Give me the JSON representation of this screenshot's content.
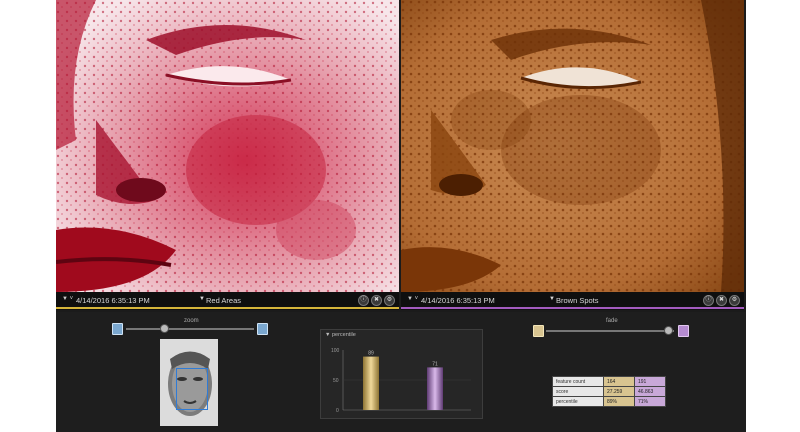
{
  "left_panel": {
    "timestamp": "4/14/2016 6:35:13 PM",
    "mode": "Red Areas",
    "accent_color": "#d6b53a",
    "tint_color": "#c2183b"
  },
  "right_panel": {
    "timestamp": "4/14/2016 6:35:13 PM",
    "mode": "Brown Spots",
    "accent_color": "#a35bbf",
    "tint_color": "#9b4a12"
  },
  "controls": {
    "info_icon": "ⓘ",
    "sync_icon": "✖",
    "gear_icon": "⚙"
  },
  "zoom": {
    "label": "zoom",
    "level": 0.3
  },
  "fade": {
    "label": "fade",
    "level": 0.95
  },
  "percentile_chart": {
    "title": "percentile",
    "ticks": [
      "100",
      "50",
      "0"
    ]
  },
  "chart_data": {
    "type": "bar",
    "categories": [
      "Red Areas",
      "Brown Spots"
    ],
    "values": [
      89,
      71
    ],
    "colors": [
      "#c9a855",
      "#9b6bb0"
    ],
    "ylim": [
      0,
      100
    ],
    "title": "percentile"
  },
  "stats_table": {
    "rows": [
      {
        "name": "feature count",
        "a": "164",
        "b": "191"
      },
      {
        "name": "score",
        "a": "27.259",
        "b": "46.863"
      },
      {
        "name": "percentile",
        "a": "89%",
        "b": "71%"
      }
    ]
  }
}
